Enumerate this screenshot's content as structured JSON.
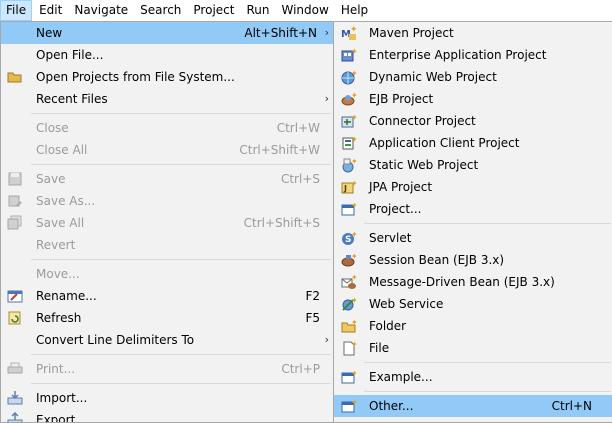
{
  "menubar": {
    "file": "File",
    "edit": "Edit",
    "navigate": "Navigate",
    "search": "Search",
    "project": "Project",
    "run": "Run",
    "window": "Window",
    "help": "Help"
  },
  "file_menu": {
    "new_label": "New",
    "new_shortcut": "Alt+Shift+N",
    "open_file": "Open File...",
    "open_projects": "Open Projects from File System...",
    "recent_files": "Recent Files",
    "close": "Close",
    "close_shortcut": "Ctrl+W",
    "close_all": "Close All",
    "close_all_shortcut": "Ctrl+Shift+W",
    "save": "Save",
    "save_shortcut": "Ctrl+S",
    "save_as": "Save As...",
    "save_all": "Save All",
    "save_all_shortcut": "Ctrl+Shift+S",
    "revert": "Revert",
    "move": "Move...",
    "rename": "Rename...",
    "rename_shortcut": "F2",
    "refresh": "Refresh",
    "refresh_shortcut": "F5",
    "convert": "Convert Line Delimiters To",
    "print": "Print...",
    "print_shortcut": "Ctrl+P",
    "import": "Import...",
    "export": "Export..."
  },
  "new_menu": {
    "maven": "Maven Project",
    "enterprise": "Enterprise Application Project",
    "dynamic_web": "Dynamic Web Project",
    "ejb": "EJB Project",
    "connector": "Connector Project",
    "app_client": "Application Client Project",
    "static_web": "Static Web Project",
    "jpa": "JPA Project",
    "project": "Project...",
    "servlet": "Servlet",
    "session_bean": "Session Bean (EJB 3.x)",
    "mdb": "Message-Driven Bean (EJB 3.x)",
    "web_service": "Web Service",
    "folder": "Folder",
    "file": "File",
    "example": "Example...",
    "other": "Other...",
    "other_shortcut": "Ctrl+N"
  },
  "colors": {
    "highlight": "#91c9f7",
    "menubar_active": "#cce8ff",
    "disabled_text": "#9b9b9b"
  }
}
